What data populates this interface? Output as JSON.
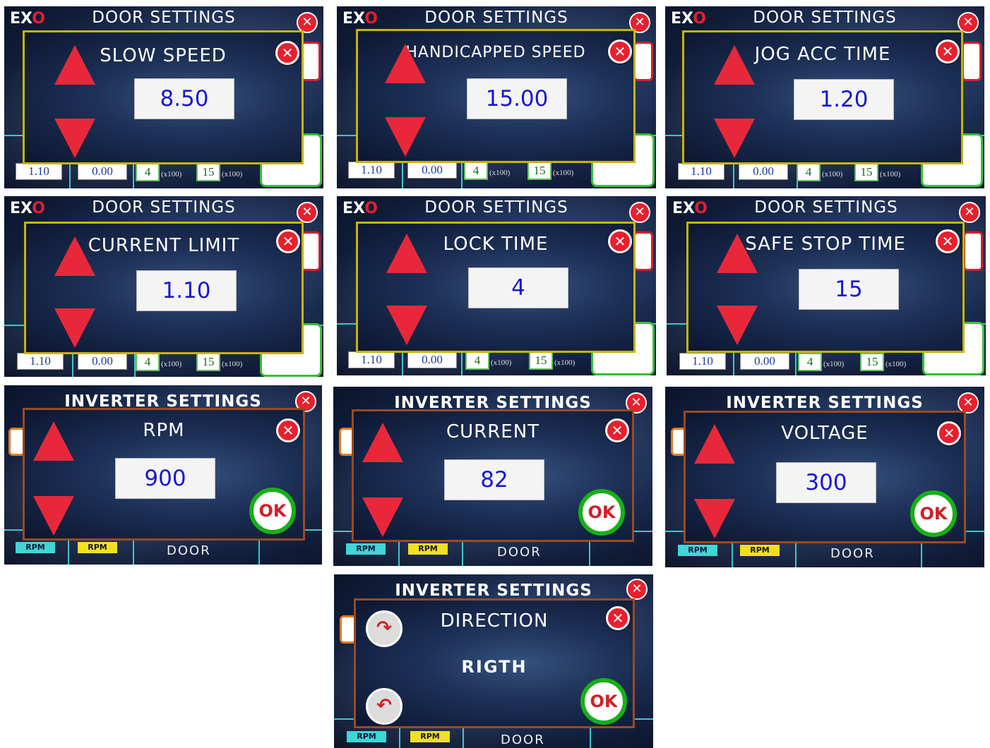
{
  "logo": {
    "left": "EX",
    "right": "O"
  },
  "screens": [
    {
      "bg_title": "DOOR SETTINGS",
      "title": "SLOW SPEED",
      "value": "8.50",
      "chips": [
        "1.10",
        "0.00",
        "4",
        "15"
      ],
      "unit": "(x100)"
    },
    {
      "bg_title": "DOOR SETTINGS",
      "title": "HANDICAPPED SPEED",
      "value": "15.00",
      "chips": [
        "1.10",
        "0.00",
        "4",
        "15"
      ],
      "unit": "(x100)"
    },
    {
      "bg_title": "DOOR SETTINGS",
      "title": "JOG ACC TIME",
      "value": "1.20",
      "chips": [
        "1.10",
        "0.00",
        "4",
        "15"
      ],
      "unit": "(x100)"
    },
    {
      "bg_title": "DOOR SETTINGS",
      "title": "CURRENT LIMIT",
      "value": "1.10",
      "chips": [
        "1.10",
        "0.00",
        "4",
        "15"
      ],
      "unit": "(x100)"
    },
    {
      "bg_title": "DOOR SETTINGS",
      "title": "LOCK TIME",
      "value": "4",
      "chips": [
        "1.10",
        "0.00",
        "4",
        "15"
      ],
      "unit": "(x100)"
    },
    {
      "bg_title": "DOOR SETTINGS",
      "title": "SAFE STOP TIME",
      "value": "15",
      "chips": [
        "1.10",
        "0.00",
        "4",
        "15"
      ],
      "unit": "(x100)"
    },
    {
      "bg_title": "INVERTER SETTINGS",
      "title": "RPM",
      "value": "900",
      "ok": "OK",
      "rpm": "RPM",
      "door": "DOOR"
    },
    {
      "bg_title": "INVERTER SETTINGS",
      "title": "CURRENT",
      "value": "82",
      "ok": "OK",
      "rpm": "RPM",
      "door": "DOOR"
    },
    {
      "bg_title": "INVERTER SETTINGS",
      "title": "VOLTAGE",
      "value": "300",
      "ok": "OK",
      "rpm": "RPM",
      "door": "DOOR"
    },
    {
      "bg_title": "INVERTER SETTINGS",
      "title": "DIRECTION",
      "value": "RIGTH",
      "ok": "OK",
      "rpm": "RPM",
      "door": "DOOR"
    }
  ],
  "icons": {
    "close": "close-icon",
    "up": "arrow-up-icon",
    "down": "arrow-down-icon",
    "rotate_cw": "rotate-clockwise-icon",
    "rotate_ccw": "rotate-counterclockwise-icon"
  },
  "colors": {
    "accent_red": "#e8283a",
    "door_border": "#c8b400",
    "inverter_border": "#9a4a22",
    "ok_green": "#17b017",
    "value_blue": "#1818d0"
  }
}
